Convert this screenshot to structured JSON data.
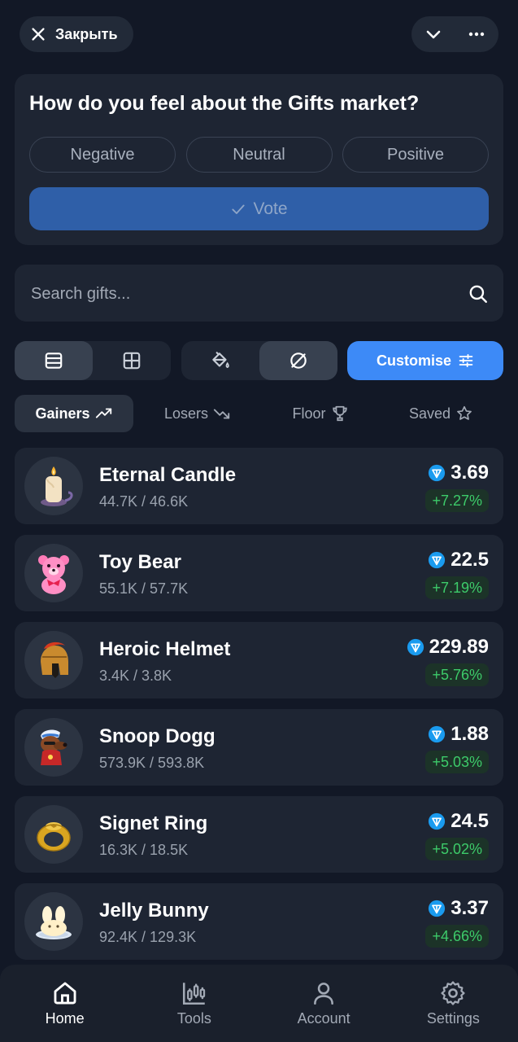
{
  "header": {
    "close_label": "Закрыть",
    "chevron_icon": "chevron-down-icon",
    "more_icon": "more-horizontal-icon"
  },
  "poll": {
    "question": "How do you feel about the Gifts market?",
    "options": [
      "Negative",
      "Neutral",
      "Positive"
    ],
    "vote_label": "Vote"
  },
  "search": {
    "placeholder": "Search gifts..."
  },
  "view_toggle": {
    "layout_options": [
      "list-view-icon",
      "grid-view-icon"
    ],
    "active_layout": "list-view-icon",
    "background_options": [
      "paint-bucket-icon",
      "no-background-icon"
    ],
    "active_background": "no-background-icon",
    "customise_label": "Customise"
  },
  "tabs": [
    {
      "label": "Gainers",
      "icon": "trending-up-icon",
      "active": true
    },
    {
      "label": "Losers",
      "icon": "trending-down-icon",
      "active": false
    },
    {
      "label": "Floor",
      "icon": "trophy-icon",
      "active": false
    },
    {
      "label": "Saved",
      "icon": "star-icon",
      "active": false
    }
  ],
  "gifts": [
    {
      "name": "Eternal Candle",
      "supply": "44.7K / 46.6K",
      "price": "3.69",
      "change": "+7.27%",
      "icon": "candle-icon"
    },
    {
      "name": "Toy Bear",
      "supply": "55.1K / 57.7K",
      "price": "22.5",
      "change": "+7.19%",
      "icon": "teddy-bear-icon"
    },
    {
      "name": "Heroic Helmet",
      "supply": "3.4K / 3.8K",
      "price": "229.89",
      "change": "+5.76%",
      "icon": "spartan-helmet-icon"
    },
    {
      "name": "Snoop Dogg",
      "supply": "573.9K / 593.8K",
      "price": "1.88",
      "change": "+5.03%",
      "icon": "dog-character-icon"
    },
    {
      "name": "Signet Ring",
      "supply": "16.3K / 18.5K",
      "price": "24.5",
      "change": "+5.02%",
      "icon": "ring-icon"
    },
    {
      "name": "Jelly Bunny",
      "supply": "92.4K / 129.3K",
      "price": "3.37",
      "change": "+4.66%",
      "icon": "jelly-bunny-icon"
    }
  ],
  "bottom_nav": [
    {
      "label": "Home",
      "icon": "home-icon",
      "active": true
    },
    {
      "label": "Tools",
      "icon": "chart-tools-icon",
      "active": false
    },
    {
      "label": "Account",
      "icon": "user-icon",
      "active": false
    },
    {
      "label": "Settings",
      "icon": "gear-icon",
      "active": false
    }
  ],
  "colors": {
    "background": "#121826",
    "card": "#1e2533",
    "accent": "#3d8af7",
    "vote_button": "#2f5fa8",
    "positive": "#3dcb6a",
    "ton": "#1a9bef"
  }
}
